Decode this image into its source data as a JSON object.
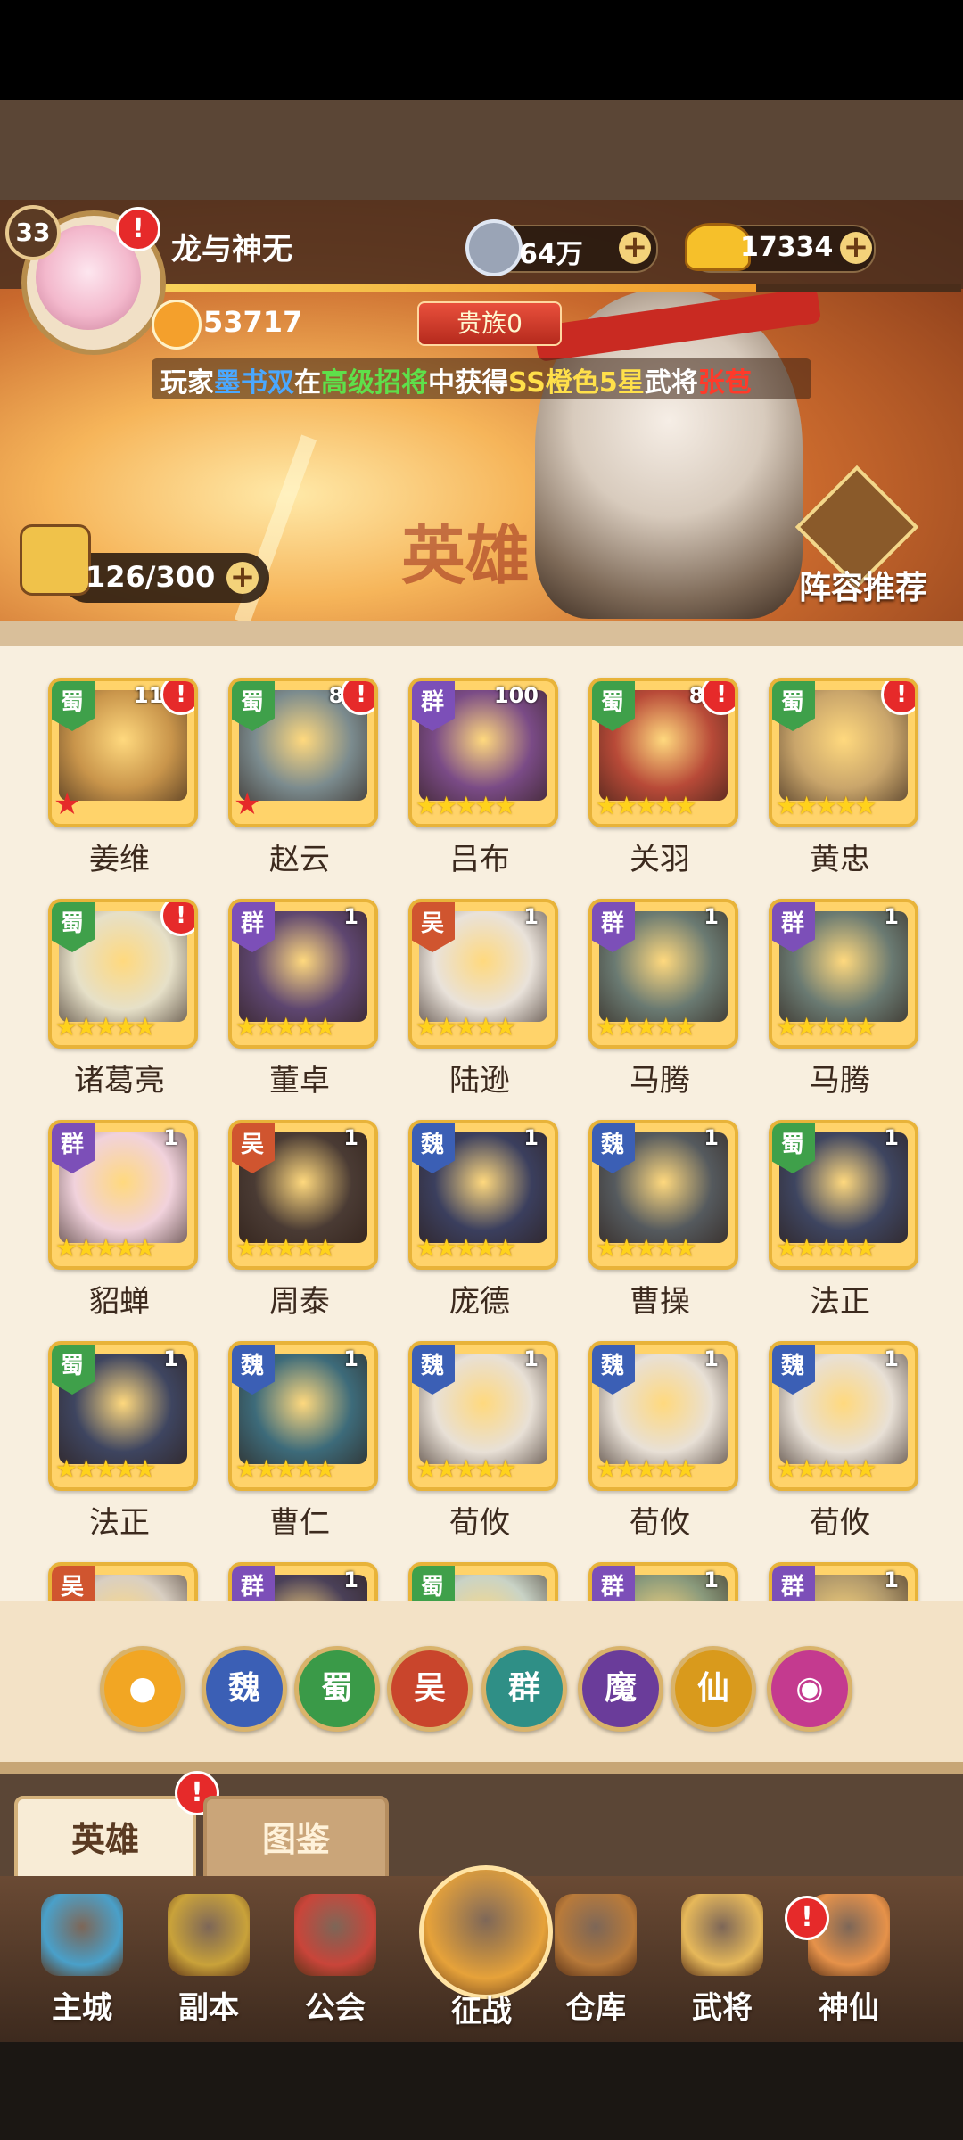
{
  "player": {
    "level": "33",
    "name": "龙与神无",
    "power": "53717",
    "noble": "贵族0"
  },
  "currency": {
    "coins": "64万",
    "gold": "17334"
  },
  "ticker": {
    "prefix": "玩家",
    "player": "墨书双",
    "mid1": "在",
    "action": "高级招将",
    "mid2": "中获得",
    "rarity": "SS橙色5星",
    "mid3": "武将",
    "hero": "张苞"
  },
  "banner": {
    "hero_count": "126/300",
    "recommend_label": "阵容推荐",
    "bg_text": "英雄"
  },
  "heroes": [
    {
      "name": "姜维",
      "faction": "蜀",
      "level": "110",
      "stars": "",
      "alert": true,
      "awaken": true,
      "color": "#c9954b"
    },
    {
      "name": "赵云",
      "faction": "蜀",
      "level": "80",
      "stars": "",
      "alert": true,
      "awaken": true,
      "color": "#7b8b8e"
    },
    {
      "name": "吕布",
      "faction": "群",
      "level": "100",
      "stars": "★★★★★",
      "alert": false,
      "awaken": false,
      "color": "#7a4b86"
    },
    {
      "name": "关羽",
      "faction": "蜀",
      "level": "88",
      "stars": "★★★★★",
      "alert": true,
      "awaken": false,
      "color": "#b84a38"
    },
    {
      "name": "黄忠",
      "faction": "蜀",
      "level": "1",
      "stars": "★★★★★",
      "alert": true,
      "awaken": false,
      "color": "#c9a56b"
    },
    {
      "name": "诸葛亮",
      "faction": "蜀",
      "level": "1",
      "stars": "★★★★★",
      "alert": true,
      "awaken": false,
      "color": "#e6e0c8"
    },
    {
      "name": "董卓",
      "faction": "群",
      "level": "1",
      "stars": "★★★★★",
      "alert": false,
      "awaken": false,
      "color": "#5e4670"
    },
    {
      "name": "陆逊",
      "faction": "吴",
      "level": "1",
      "stars": "★★★★★",
      "alert": false,
      "awaken": false,
      "color": "#e9e2da"
    },
    {
      "name": "马腾",
      "faction": "群",
      "level": "1",
      "stars": "★★★★★",
      "alert": false,
      "awaken": false,
      "color": "#6a7a72"
    },
    {
      "name": "马腾",
      "faction": "群",
      "level": "1",
      "stars": "★★★★★",
      "alert": false,
      "awaken": false,
      "color": "#6a7a72"
    },
    {
      "name": "貂蝉",
      "faction": "群",
      "level": "1",
      "stars": "★★★★★",
      "alert": false,
      "awaken": false,
      "color": "#f1d2dc"
    },
    {
      "name": "周泰",
      "faction": "吴",
      "level": "1",
      "stars": "★★★★★",
      "alert": false,
      "awaken": false,
      "color": "#4a3b34"
    },
    {
      "name": "庞德",
      "faction": "魏",
      "level": "1",
      "stars": "★★★★★",
      "alert": false,
      "awaken": false,
      "color": "#3b3f5e"
    },
    {
      "name": "曹操",
      "faction": "魏",
      "level": "1",
      "stars": "★★★★★",
      "alert": false,
      "awaken": false,
      "color": "#555a5e"
    },
    {
      "name": "法正",
      "faction": "蜀",
      "level": "1",
      "stars": "★★★★★",
      "alert": false,
      "awaken": false,
      "color": "#3e4560"
    },
    {
      "name": "法正",
      "faction": "蜀",
      "level": "1",
      "stars": "★★★★★",
      "alert": false,
      "awaken": false,
      "color": "#3e4560"
    },
    {
      "name": "曹仁",
      "faction": "魏",
      "level": "1",
      "stars": "★★★★★",
      "alert": false,
      "awaken": false,
      "color": "#3d6b7a"
    },
    {
      "name": "荀攸",
      "faction": "魏",
      "level": "1",
      "stars": "★★★★★",
      "alert": false,
      "awaken": false,
      "color": "#e8e0d6"
    },
    {
      "name": "荀攸",
      "faction": "魏",
      "level": "1",
      "stars": "★★★★★",
      "alert": false,
      "awaken": false,
      "color": "#e8e0d6"
    },
    {
      "name": "荀攸",
      "faction": "魏",
      "level": "1",
      "stars": "★★★★★",
      "alert": false,
      "awaken": false,
      "color": "#e8e0d6"
    },
    {
      "name": "",
      "faction": "吴",
      "level": "",
      "stars": "",
      "alert": false,
      "awaken": false,
      "color": "#d9cfc2"
    },
    {
      "name": "",
      "faction": "群",
      "level": "1",
      "stars": "",
      "alert": false,
      "awaken": false,
      "color": "#4a4058"
    },
    {
      "name": "",
      "faction": "蜀",
      "level": "",
      "stars": "",
      "alert": false,
      "awaken": false,
      "color": "#c9d3c6"
    },
    {
      "name": "",
      "faction": "群",
      "level": "1",
      "stars": "",
      "alert": false,
      "awaken": false,
      "color": "#8a9a7c"
    },
    {
      "name": "",
      "faction": "群",
      "level": "1",
      "stars": "",
      "alert": false,
      "awaken": false,
      "color": "#b29a6c"
    }
  ],
  "filters": [
    {
      "label": "",
      "icon": "paw-icon",
      "color": "#f2a623"
    },
    {
      "label": "魏",
      "color": "#3b5fb5"
    },
    {
      "label": "蜀",
      "color": "#3a9a48"
    },
    {
      "label": "吴",
      "color": "#c9452c"
    },
    {
      "label": "群",
      "color": "#2f8f86"
    },
    {
      "label": "魔",
      "color": "#6a3c9a"
    },
    {
      "label": "仙",
      "color": "#d99a1c"
    },
    {
      "label": "",
      "icon": "swirl-icon",
      "color": "#c43a8f"
    }
  ],
  "tabs": {
    "hero": "英雄",
    "atlas": "图鉴"
  },
  "nav": [
    {
      "label": "主城",
      "icon": "castle-icon",
      "color": "#4aa0c9"
    },
    {
      "label": "副本",
      "icon": "sword-icon",
      "color": "#c9a23a"
    },
    {
      "label": "公会",
      "icon": "flag-icon",
      "color": "#c9453a"
    },
    {
      "label": "征战",
      "icon": "battle-icon",
      "color": "#e6a23a"
    },
    {
      "label": "仓库",
      "icon": "bag-icon",
      "color": "#b87a3a"
    },
    {
      "label": "武将",
      "icon": "cat-general-icon",
      "color": "#e6b85a"
    },
    {
      "label": "神仙",
      "icon": "cat-face-icon",
      "color": "#e6924a"
    }
  ]
}
